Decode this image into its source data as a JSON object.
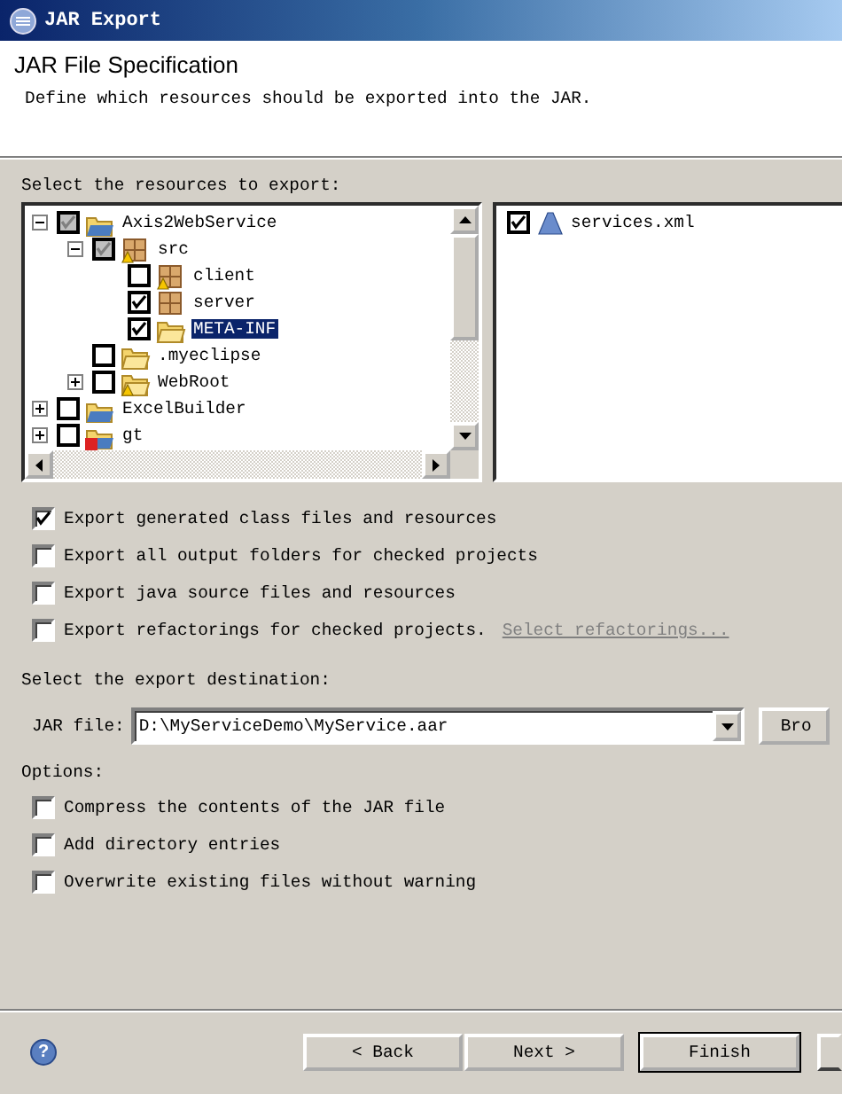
{
  "window": {
    "title": "JAR Export"
  },
  "header": {
    "title": "JAR File Specification",
    "description": "Define which resources should be exported into the JAR."
  },
  "resources": {
    "label": "Select the resources to export:",
    "tree": [
      {
        "label": "Axis2WebService",
        "kind": "project",
        "checked": true,
        "grayed": true,
        "expanded": true,
        "selected": false,
        "warning": false,
        "error": false,
        "children": [
          {
            "label": "src",
            "kind": "package",
            "checked": true,
            "grayed": true,
            "expanded": true,
            "selected": false,
            "warning": true,
            "error": false,
            "children": [
              {
                "label": "client",
                "kind": "package",
                "checked": false,
                "grayed": false,
                "selected": false,
                "warning": true,
                "error": false
              },
              {
                "label": "server",
                "kind": "package",
                "checked": true,
                "grayed": false,
                "selected": false,
                "warning": false,
                "error": false
              },
              {
                "label": "META-INF",
                "kind": "folder",
                "checked": true,
                "grayed": false,
                "selected": true,
                "warning": false,
                "error": false
              }
            ]
          },
          {
            "label": ".myeclipse",
            "kind": "folder",
            "checked": false,
            "grayed": false,
            "selected": false,
            "warning": false,
            "error": false
          },
          {
            "label": "WebRoot",
            "kind": "folder",
            "checked": false,
            "grayed": false,
            "expanded": false,
            "selected": false,
            "warning": true,
            "error": false
          }
        ]
      },
      {
        "label": "ExcelBuilder",
        "kind": "project",
        "checked": false,
        "grayed": false,
        "expanded": false,
        "selected": false,
        "warning": false,
        "error": false
      },
      {
        "label": "gt",
        "kind": "project",
        "checked": false,
        "grayed": false,
        "expanded": false,
        "selected": false,
        "warning": false,
        "error": true
      }
    ],
    "files": [
      {
        "label": "services.xml",
        "checked": true
      }
    ]
  },
  "export_options": [
    {
      "label": "Export generated class files and resources",
      "checked": true
    },
    {
      "label": "Export all output folders for checked projects",
      "checked": false
    },
    {
      "label": "Export java source files and resources",
      "checked": false
    },
    {
      "label": "Export refactorings for checked projects.",
      "checked": false,
      "link": {
        "text": "Select refactorings...",
        "disabled": true
      }
    }
  ],
  "destination": {
    "label": "Select the export destination:",
    "field_label": "JAR file:",
    "value": "D:\\MyServiceDemo\\MyService.aar",
    "browse": "Bro"
  },
  "options": {
    "label": "Options:",
    "items": [
      {
        "label": "Compress the contents of the JAR file",
        "checked": false
      },
      {
        "label": "Add directory entries",
        "checked": false
      },
      {
        "label": "Overwrite existing files without warning",
        "checked": false
      }
    ]
  },
  "help": {
    "glyph": "?"
  },
  "buttons": [
    {
      "label": "< Back",
      "default": false
    },
    {
      "label": "Next >",
      "default": false
    },
    {
      "label": "Finish",
      "default": true
    }
  ]
}
